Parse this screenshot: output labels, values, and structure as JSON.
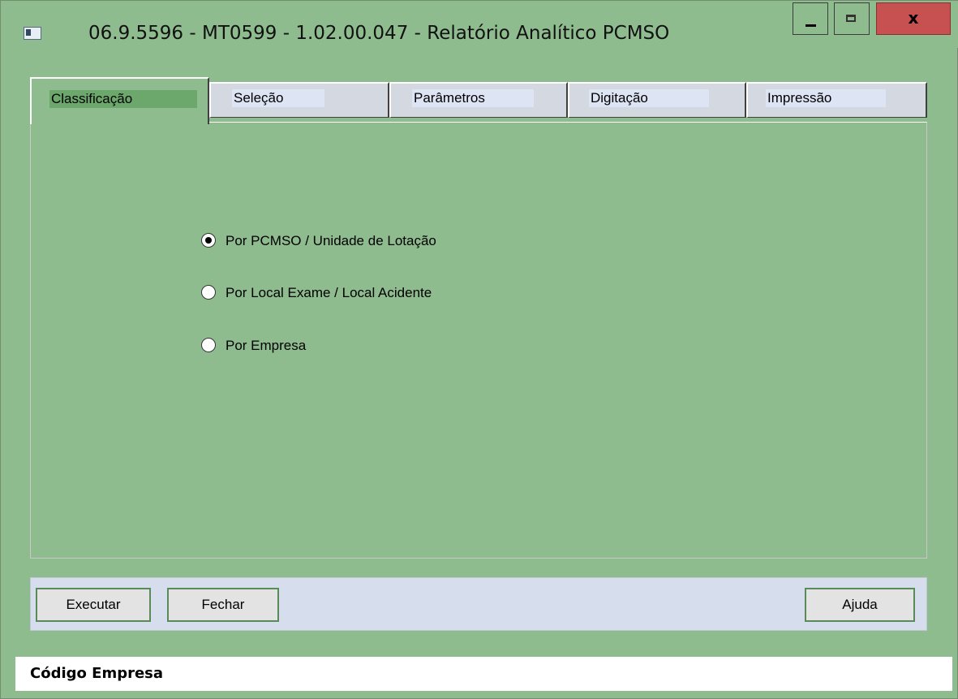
{
  "window": {
    "title": "06.9.5596 - MT0599 - 1.02.00.047 - Relatório Analítico PCMSO",
    "close_label": "x"
  },
  "tabs": [
    {
      "label": "Classificação",
      "active": true
    },
    {
      "label": "Seleção",
      "active": false
    },
    {
      "label": "Parâmetros",
      "active": false
    },
    {
      "label": "Digitação",
      "active": false
    },
    {
      "label": "Impressão",
      "active": false
    }
  ],
  "classificacao": {
    "options": [
      {
        "label": "Por PCMSO / Unidade de Lotação",
        "selected": true
      },
      {
        "label": "Por Local Exame / Local Acidente",
        "selected": false
      },
      {
        "label": "Por Empresa",
        "selected": false
      }
    ]
  },
  "buttons": {
    "executar": "Executar",
    "fechar": "Fechar",
    "ajuda": "Ajuda"
  },
  "status": {
    "text": "Código Empresa"
  },
  "colors": {
    "background": "#8fbc8f",
    "button_bar": "#d6deee",
    "close_button": "#c75050"
  }
}
